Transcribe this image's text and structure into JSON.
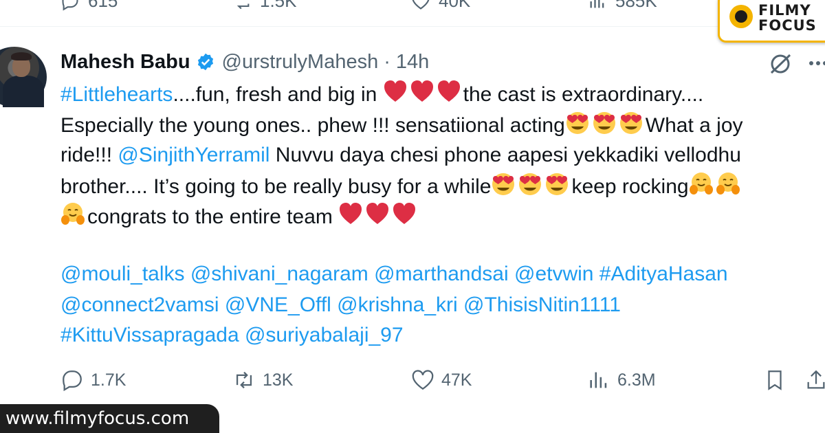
{
  "previous_tweet_actions": {
    "reply_count": "615",
    "repost_count": "1.5K",
    "like_count": "40K",
    "view_count": "585K"
  },
  "tweet": {
    "author_name": "Mahesh Babu",
    "handle": "@urstrulyMahesh",
    "separator": "·",
    "time": "14h",
    "text_parts": {
      "hashtag_littlehearts": "#Littlehearts",
      "p1": "....fun, fresh and big in ",
      "p2": "the cast is extraordinary....",
      "p3": "Especially the young ones.. phew !!! sensatiional acting",
      "p4": "What a joy",
      "p5": "ride!!! ",
      "mention_sinjith": "@SinjithYerramil",
      "p6": " Nuvvu daya chesi phone aapesi yekkadiki vellodhu",
      "p7": "brother.... It’s going to be really busy for a while",
      "p8": "keep rocking",
      "p9": "congrats to the entire team "
    },
    "mentions_line1": "@mouli_talks @shivani_nagaram @marthandsai @etvwin #AdityaHasan",
    "mentions_line2": "@connect2vamsi @VNE_Offl @krishna_kri @ThisisNitin1111",
    "mentions_line3": "#KittuVissapragada @suriyabalaji_97",
    "emoji_names": [
      "red-heart",
      "smiling-face-with-heart-eyes",
      "hugging-face"
    ]
  },
  "actions": {
    "replies": "1.7K",
    "reposts": "13K",
    "likes": "47K",
    "views": "6.3M"
  },
  "watermark": {
    "url": "www.filmyfocus.com",
    "logo_line1": "FILMY",
    "logo_line2": "FOCUS"
  },
  "colors": {
    "link": "#1d9bf0",
    "text": "#0f1419",
    "muted": "#536471",
    "heart": "#e0245e",
    "logo_accent": "#f4b400"
  }
}
